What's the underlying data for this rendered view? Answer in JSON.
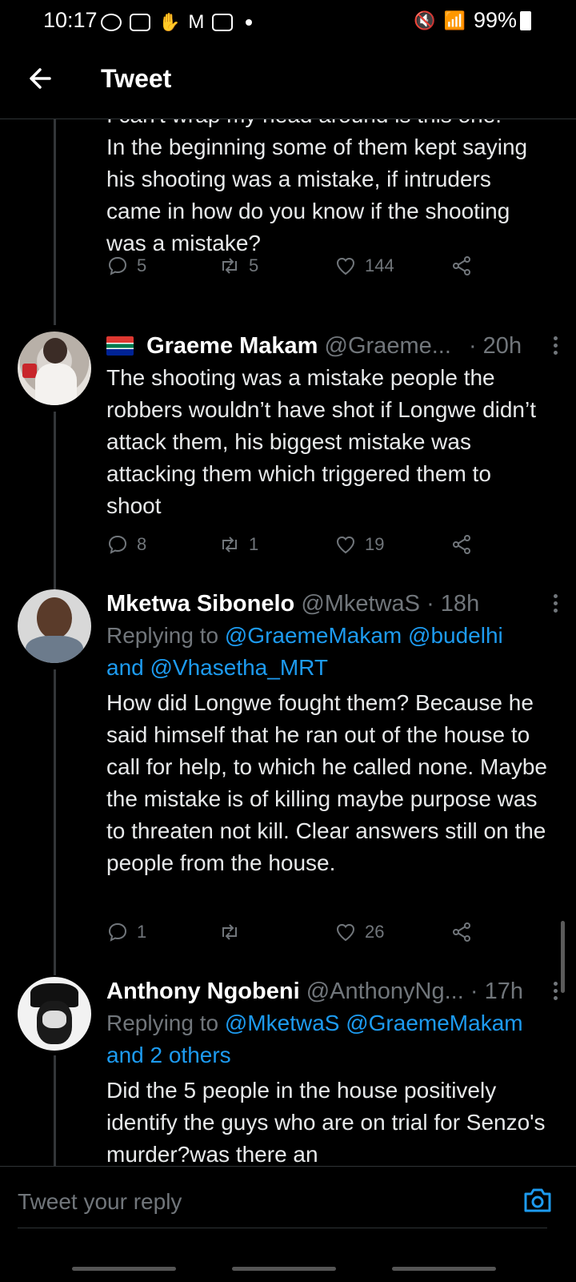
{
  "status_bar": {
    "time": "10:17",
    "battery": "99%"
  },
  "header": {
    "title": "Tweet"
  },
  "tweets": [
    {
      "text": "I can't wrap my head around is this one.\nIn the beginning some of them kept saying his shooting was a mistake, if intruders came in how do you know if the shooting was a mistake?",
      "replies": "5",
      "retweets": "5",
      "likes": "144"
    },
    {
      "name": "Graeme Makam",
      "handle": "@Graeme...",
      "time": "· 20h",
      "text": "The shooting was a mistake people the robbers wouldn’t have shot if Longwe didn’t attack them, his biggest mistake was attacking them which triggered them to shoot",
      "replies": "8",
      "retweets": "1",
      "likes": "19"
    },
    {
      "name": "Mketwa Sibonelo",
      "handle": "@MketwaS",
      "time": "· 18h",
      "replying_prefix": "Replying to",
      "replying_a": "@GraemeMakam @budelhi",
      "replying_and": "and",
      "replying_b": "@Vhasetha_MRT",
      "text": "How did Longwe fought them? Because he said himself that he ran out of the house to call for help, to which he called none. Maybe the mistake is of killing maybe purpose was to threaten not kill. Clear answers still on the people from the house.",
      "replies": "1",
      "retweets": "",
      "likes": "26"
    },
    {
      "name": "Anthony Ngobeni",
      "handle": "@AnthonyNg...",
      "time": "· 17h",
      "replying_prefix": "Replying to",
      "replying_a": "@MketwaS @GraemeMakam",
      "replying_b": "and 2 others",
      "text": "Did the 5 people in the house positively identify the guys who are on trial for Senzo's murder?was there an"
    }
  ],
  "composer": {
    "placeholder": "Tweet your reply"
  }
}
